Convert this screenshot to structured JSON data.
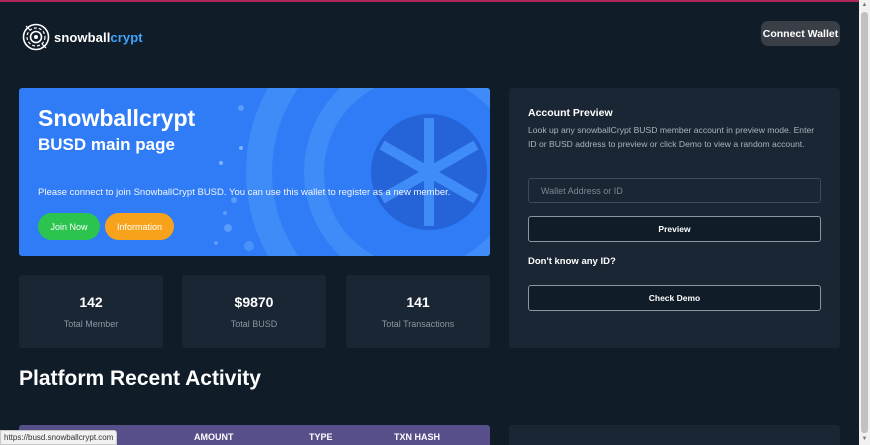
{
  "header": {
    "logo_text_a": "snowball",
    "logo_text_b": "crypt",
    "connect_label": "Connect Wallet"
  },
  "hero": {
    "title": "Snowballcrypt",
    "subtitle": "BUSD main page",
    "description": "Please connect to join SnowballCrypt BUSD. You can use this wallet to register as a new member.",
    "join_label": "Join Now",
    "info_label": "Information"
  },
  "stats": [
    {
      "value": "142",
      "label": "Total Member"
    },
    {
      "value": "$9870",
      "label": "Total BUSD"
    },
    {
      "value": "141",
      "label": "Total Transactions"
    }
  ],
  "preview": {
    "title": "Account Preview",
    "description": "Look up any snowballCrypt BUSD member account in preview mode. Enter ID or BUSD address to preview or click Demo to view a random account.",
    "input_placeholder": "Wallet Address or ID",
    "preview_label": "Preview",
    "dont_know": "Don't know any ID?",
    "demo_label": "Check Demo"
  },
  "activity": {
    "title": "Platform Recent Activity",
    "columns": [
      "AMOUNT",
      "TYPE",
      "TXN HASH"
    ]
  },
  "status_url": "https://busd.snowballcrypt.com",
  "colors": {
    "background": "#101c28",
    "card": "#1a2633",
    "hero_blue": "#2f7cf6",
    "join_green": "#2bc44f",
    "info_orange": "#f7a21b",
    "accent_blue": "#3ea6ff",
    "table_header": "#574f8a"
  },
  "icons": {
    "logo": "snowball-logo-icon",
    "hero_decoration": "snowflake-icon"
  }
}
